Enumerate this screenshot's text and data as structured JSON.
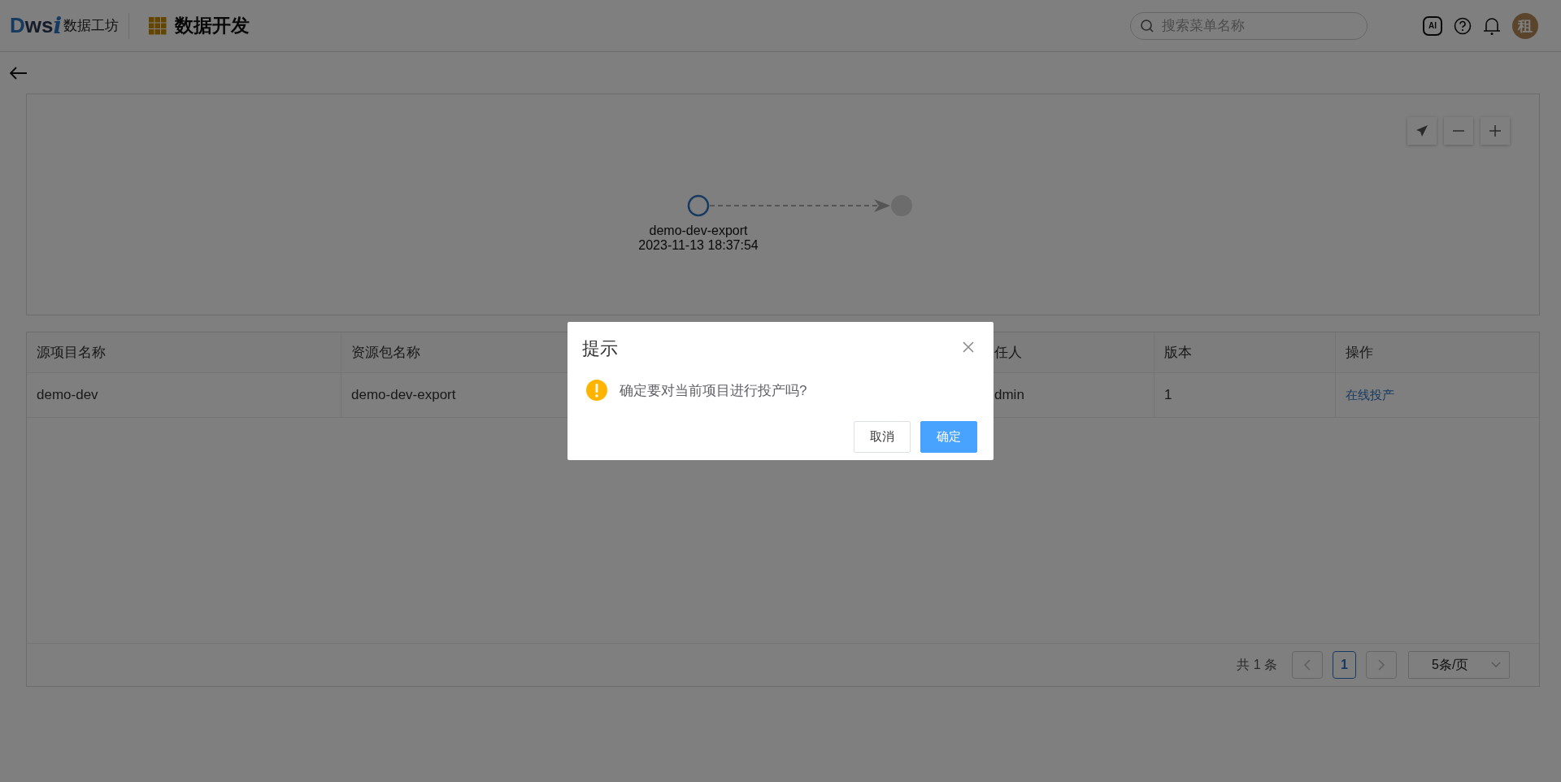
{
  "header": {
    "logo": {
      "mark": "Dws",
      "accent": "i",
      "name": "数据工坊"
    },
    "module_title": "数据开发",
    "search": {
      "placeholder": "搜索菜单名称"
    },
    "ai_badge": "AI",
    "avatar": "租"
  },
  "graph": {
    "nodes": [
      {
        "kind": "source",
        "label": "demo-dev-export",
        "time": "2023-11-13 18:37:54"
      },
      {
        "kind": "target"
      }
    ]
  },
  "table": {
    "columns": [
      "源项目名称",
      "资源包名称",
      "任人",
      "版本",
      "操作"
    ],
    "rows": [
      {
        "cells": [
          "demo-dev",
          "demo-dev-export",
          "dmin",
          "1"
        ],
        "action": "在线投产"
      }
    ]
  },
  "pagination": {
    "total": "共 1 条",
    "pages": [
      {
        "label": "1",
        "selected": true
      }
    ],
    "page_size": "5条/页"
  },
  "dialog": {
    "title": "提示",
    "message": "确定要对当前项目进行投产吗?",
    "buttons": [
      {
        "label": "取消",
        "kind": "default"
      },
      {
        "label": "确定",
        "kind": "primary"
      }
    ]
  }
}
